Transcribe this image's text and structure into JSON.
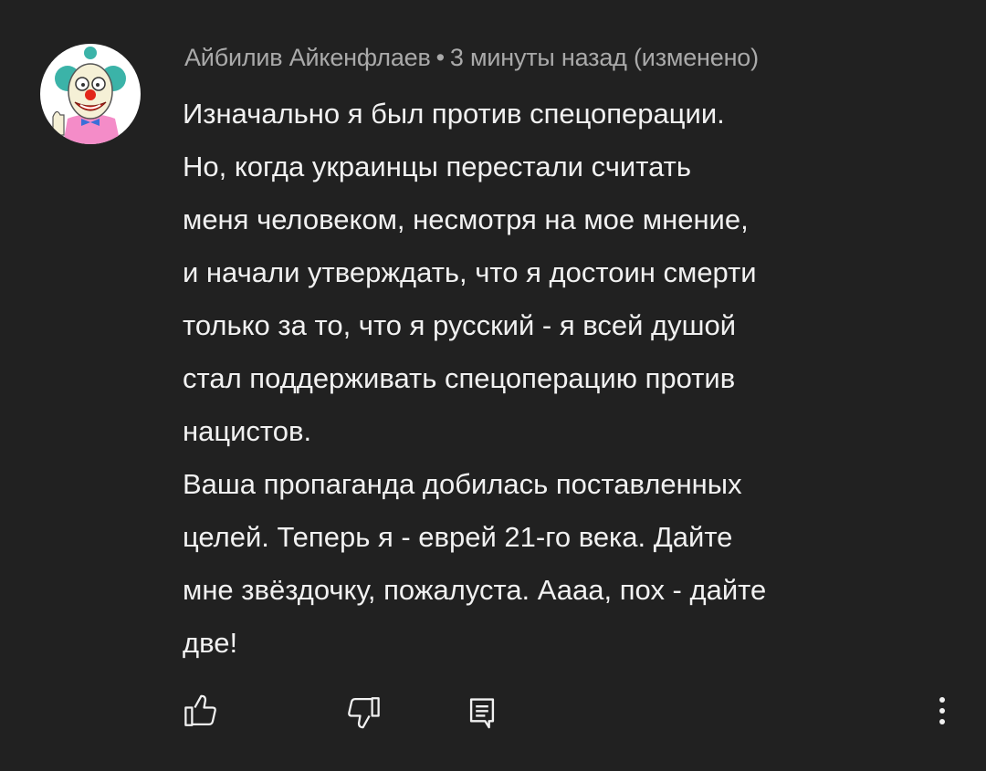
{
  "comment": {
    "author": "Айбилив Айкенфлаев",
    "separator": "•",
    "time": "3 минуты назад",
    "edited": "(изменено)",
    "lines": [
      "Изначально я был против спецоперации.",
      "Но, когда украинцы перестали считать",
      "меня человеком, несмотря на мое мнение,",
      "и начали утверждать, что я достоин смерти",
      "только за то, что я русский - я всей душой",
      "стал поддерживать спецоперацию против",
      "нацистов.",
      "Ваша пропаганда добилась поставленных",
      "целей. Теперь я - еврей 21-го века. Дайте",
      "мне звёздочку, пожалуста. Аааа, пох - дайте",
      "две!"
    ]
  },
  "actions": {
    "like_icon": "thumb-up-icon",
    "dislike_icon": "thumb-down-icon",
    "reply_icon": "reply-icon",
    "more_icon": "more-vertical-icon"
  },
  "colors": {
    "background": "#212121",
    "text": "#f1f1f1",
    "meta": "#aaaaaa",
    "icon": "#f1f1f1"
  }
}
